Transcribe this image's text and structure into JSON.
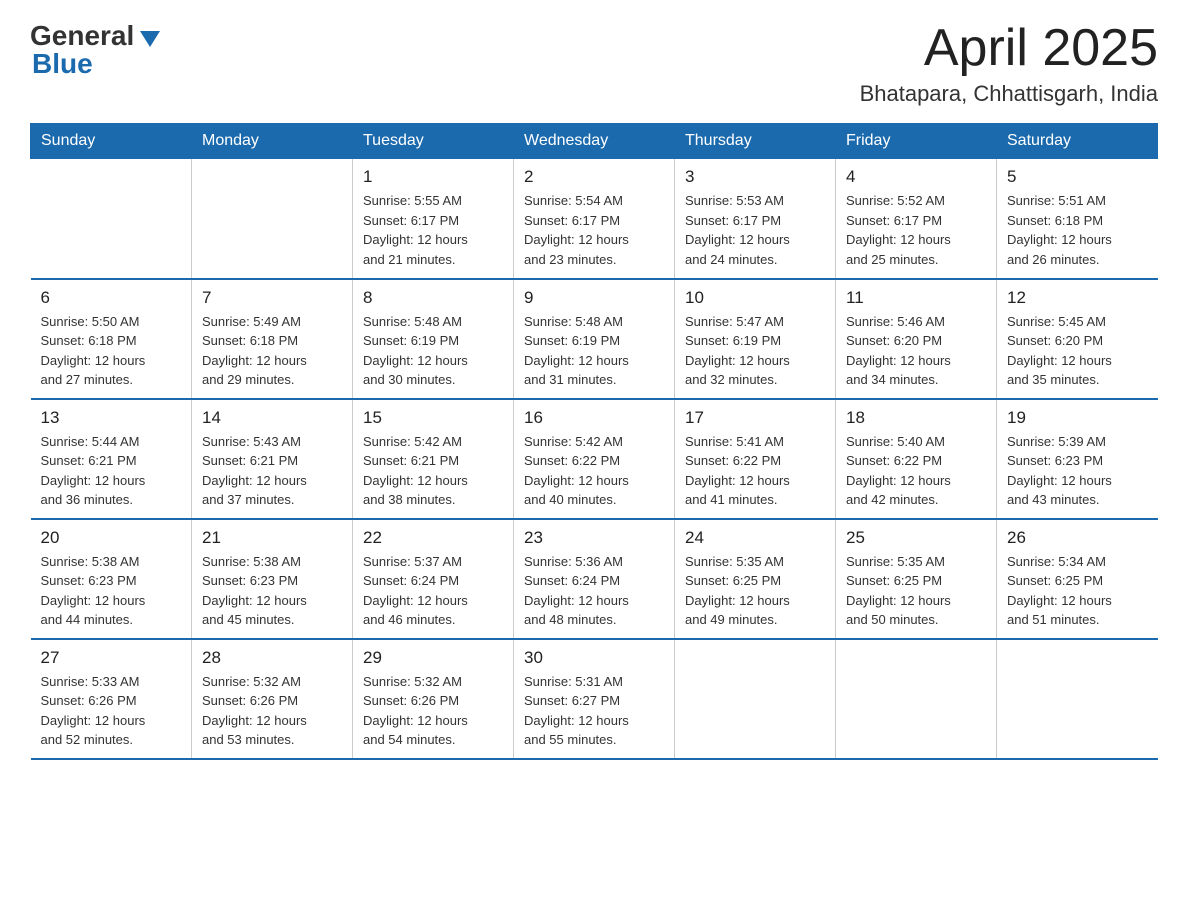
{
  "header": {
    "logo_general": "General",
    "logo_blue": "Blue",
    "title": "April 2025",
    "location": "Bhatapara, Chhattisgarh, India"
  },
  "days_of_week": [
    "Sunday",
    "Monday",
    "Tuesday",
    "Wednesday",
    "Thursday",
    "Friday",
    "Saturday"
  ],
  "weeks": [
    [
      {
        "num": "",
        "info": ""
      },
      {
        "num": "",
        "info": ""
      },
      {
        "num": "1",
        "info": "Sunrise: 5:55 AM\nSunset: 6:17 PM\nDaylight: 12 hours\nand 21 minutes."
      },
      {
        "num": "2",
        "info": "Sunrise: 5:54 AM\nSunset: 6:17 PM\nDaylight: 12 hours\nand 23 minutes."
      },
      {
        "num": "3",
        "info": "Sunrise: 5:53 AM\nSunset: 6:17 PM\nDaylight: 12 hours\nand 24 minutes."
      },
      {
        "num": "4",
        "info": "Sunrise: 5:52 AM\nSunset: 6:17 PM\nDaylight: 12 hours\nand 25 minutes."
      },
      {
        "num": "5",
        "info": "Sunrise: 5:51 AM\nSunset: 6:18 PM\nDaylight: 12 hours\nand 26 minutes."
      }
    ],
    [
      {
        "num": "6",
        "info": "Sunrise: 5:50 AM\nSunset: 6:18 PM\nDaylight: 12 hours\nand 27 minutes."
      },
      {
        "num": "7",
        "info": "Sunrise: 5:49 AM\nSunset: 6:18 PM\nDaylight: 12 hours\nand 29 minutes."
      },
      {
        "num": "8",
        "info": "Sunrise: 5:48 AM\nSunset: 6:19 PM\nDaylight: 12 hours\nand 30 minutes."
      },
      {
        "num": "9",
        "info": "Sunrise: 5:48 AM\nSunset: 6:19 PM\nDaylight: 12 hours\nand 31 minutes."
      },
      {
        "num": "10",
        "info": "Sunrise: 5:47 AM\nSunset: 6:19 PM\nDaylight: 12 hours\nand 32 minutes."
      },
      {
        "num": "11",
        "info": "Sunrise: 5:46 AM\nSunset: 6:20 PM\nDaylight: 12 hours\nand 34 minutes."
      },
      {
        "num": "12",
        "info": "Sunrise: 5:45 AM\nSunset: 6:20 PM\nDaylight: 12 hours\nand 35 minutes."
      }
    ],
    [
      {
        "num": "13",
        "info": "Sunrise: 5:44 AM\nSunset: 6:21 PM\nDaylight: 12 hours\nand 36 minutes."
      },
      {
        "num": "14",
        "info": "Sunrise: 5:43 AM\nSunset: 6:21 PM\nDaylight: 12 hours\nand 37 minutes."
      },
      {
        "num": "15",
        "info": "Sunrise: 5:42 AM\nSunset: 6:21 PM\nDaylight: 12 hours\nand 38 minutes."
      },
      {
        "num": "16",
        "info": "Sunrise: 5:42 AM\nSunset: 6:22 PM\nDaylight: 12 hours\nand 40 minutes."
      },
      {
        "num": "17",
        "info": "Sunrise: 5:41 AM\nSunset: 6:22 PM\nDaylight: 12 hours\nand 41 minutes."
      },
      {
        "num": "18",
        "info": "Sunrise: 5:40 AM\nSunset: 6:22 PM\nDaylight: 12 hours\nand 42 minutes."
      },
      {
        "num": "19",
        "info": "Sunrise: 5:39 AM\nSunset: 6:23 PM\nDaylight: 12 hours\nand 43 minutes."
      }
    ],
    [
      {
        "num": "20",
        "info": "Sunrise: 5:38 AM\nSunset: 6:23 PM\nDaylight: 12 hours\nand 44 minutes."
      },
      {
        "num": "21",
        "info": "Sunrise: 5:38 AM\nSunset: 6:23 PM\nDaylight: 12 hours\nand 45 minutes."
      },
      {
        "num": "22",
        "info": "Sunrise: 5:37 AM\nSunset: 6:24 PM\nDaylight: 12 hours\nand 46 minutes."
      },
      {
        "num": "23",
        "info": "Sunrise: 5:36 AM\nSunset: 6:24 PM\nDaylight: 12 hours\nand 48 minutes."
      },
      {
        "num": "24",
        "info": "Sunrise: 5:35 AM\nSunset: 6:25 PM\nDaylight: 12 hours\nand 49 minutes."
      },
      {
        "num": "25",
        "info": "Sunrise: 5:35 AM\nSunset: 6:25 PM\nDaylight: 12 hours\nand 50 minutes."
      },
      {
        "num": "26",
        "info": "Sunrise: 5:34 AM\nSunset: 6:25 PM\nDaylight: 12 hours\nand 51 minutes."
      }
    ],
    [
      {
        "num": "27",
        "info": "Sunrise: 5:33 AM\nSunset: 6:26 PM\nDaylight: 12 hours\nand 52 minutes."
      },
      {
        "num": "28",
        "info": "Sunrise: 5:32 AM\nSunset: 6:26 PM\nDaylight: 12 hours\nand 53 minutes."
      },
      {
        "num": "29",
        "info": "Sunrise: 5:32 AM\nSunset: 6:26 PM\nDaylight: 12 hours\nand 54 minutes."
      },
      {
        "num": "30",
        "info": "Sunrise: 5:31 AM\nSunset: 6:27 PM\nDaylight: 12 hours\nand 55 minutes."
      },
      {
        "num": "",
        "info": ""
      },
      {
        "num": "",
        "info": ""
      },
      {
        "num": "",
        "info": ""
      }
    ]
  ]
}
